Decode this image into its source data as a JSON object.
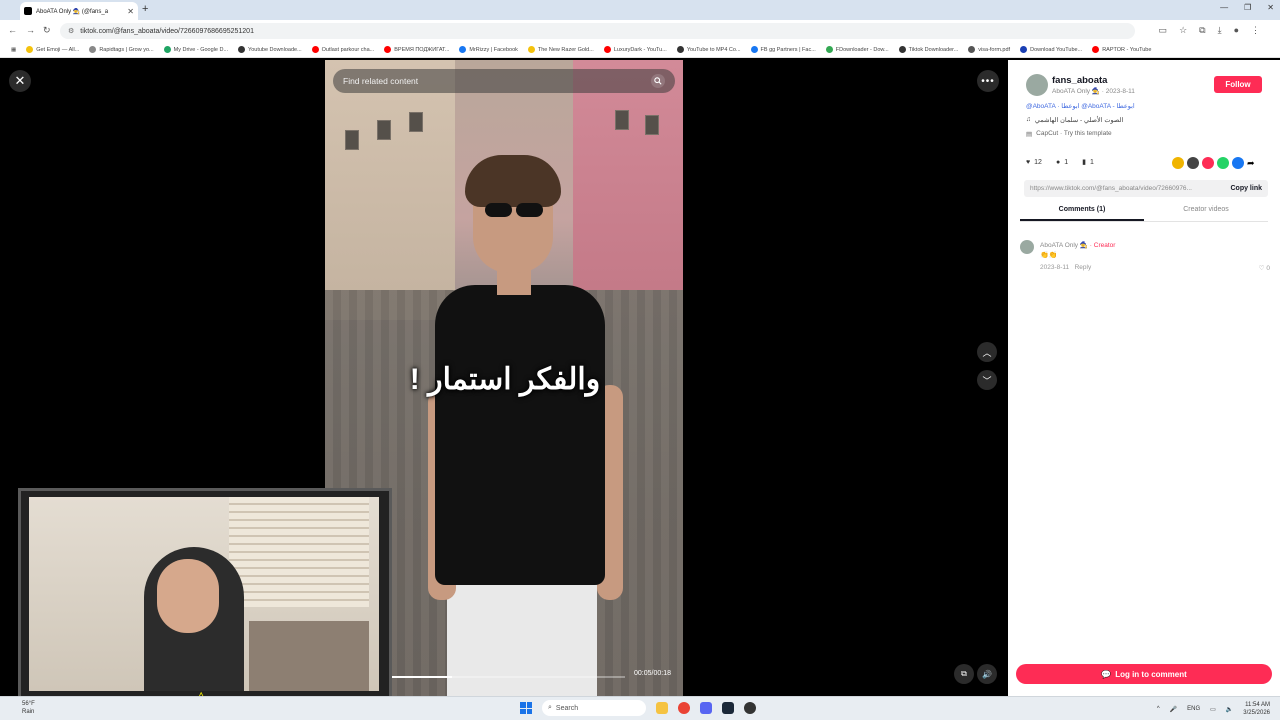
{
  "browser": {
    "tab_title": "AboATA Only 🧙 (@fans_a",
    "url": "tiktok.com/@fans_aboata/video/7266097686695251201",
    "bookmarks": [
      {
        "label": "Get Emoji — All...",
        "color": "#f4c20d"
      },
      {
        "label": "Rapidtags | Grow yo...",
        "color": "#888888"
      },
      {
        "label": "My Drive - Google D...",
        "color": "#1fa463"
      },
      {
        "label": "Youtube Downloade...",
        "color": "#333333"
      },
      {
        "label": "Outlast parkour cha...",
        "color": "#ff0000"
      },
      {
        "label": "ВРЕМЯ ПОДЖИГАТ...",
        "color": "#ff0000"
      },
      {
        "label": "MrRizzy | Facebook",
        "color": "#1877f2"
      },
      {
        "label": "The New Razer Gold...",
        "color": "#f4c20d"
      },
      {
        "label": "LuxuryDark - YouTu...",
        "color": "#ff0000"
      },
      {
        "label": "YouTube to MP4 Co...",
        "color": "#333333"
      },
      {
        "label": "FB gg Partners | Fac...",
        "color": "#1877f2"
      },
      {
        "label": "FDownloader - Dow...",
        "color": "#34a853"
      },
      {
        "label": "Tiktok Downloader...",
        "color": "#333333"
      },
      {
        "label": "visa-form.pdf",
        "color": "#555555"
      },
      {
        "label": "Download YouTube...",
        "color": "#1a3fb4"
      },
      {
        "label": "RAPTOR - YouTube",
        "color": "#ff0000"
      }
    ]
  },
  "video": {
    "search_placeholder": "Find related content",
    "overlay_text": "والفكر استمار !",
    "time": "00:05/00:18",
    "progress": 0.28
  },
  "panel": {
    "username": "fans_aboata",
    "subline": "AboATA Only 🧙 · 2023-8-11",
    "follow_label": "Follow",
    "description": "@AboATA · ابوعطا @AboATA - ابوعطا",
    "sound": "الصوت الأصلي - سلمان الهاشمي",
    "capcut": "CapCut · Try this template",
    "likes": "12",
    "comments_count": "1",
    "saves": "1",
    "share_link": "https://www.tiktok.com/@fans_aboata/video/72660976...",
    "copy_label": "Copy link",
    "tab_comments": "Comments (1)",
    "tab_creator": "Creator videos",
    "comment": {
      "author": "AboATA Only 🧙",
      "creator_tag": " · Creator",
      "text": "👏👏",
      "date": "2023-8-11",
      "reply_label": "Reply",
      "likes": "0"
    },
    "login_label": "Log in to comment",
    "accent": "#fe2c55"
  },
  "taskbar": {
    "weather_temp": "56°F",
    "weather_desc": "Rain",
    "search_label": "Search",
    "lang": "ENG",
    "time": "11:54 AM",
    "date": "3/25/2026"
  }
}
